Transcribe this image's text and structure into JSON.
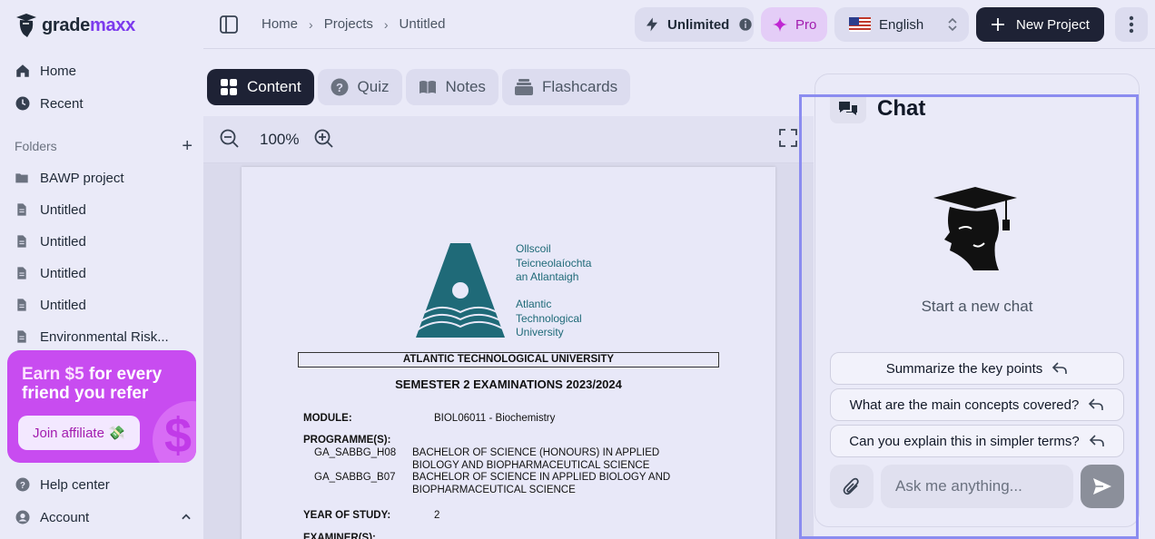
{
  "brand": {
    "part1": "grade",
    "part2": "maxx"
  },
  "sidebar": {
    "nav": [
      {
        "label": "Home"
      },
      {
        "label": "Recent"
      }
    ],
    "folders_label": "Folders",
    "folders_add": "+",
    "items": [
      {
        "label": "BAWP project",
        "type": "folder"
      },
      {
        "label": "Untitled",
        "type": "doc"
      },
      {
        "label": "Untitled",
        "type": "doc"
      },
      {
        "label": "Untitled",
        "type": "doc"
      },
      {
        "label": "Untitled",
        "type": "doc"
      },
      {
        "label": "Environmental Risk...",
        "type": "doc"
      }
    ],
    "promo": {
      "line1_highlight": "Earn $5",
      "line1_rest": " for every",
      "line2": "friend you refer",
      "button": "Join affiliate 💸",
      "badge": "$"
    },
    "help": "Help center",
    "account": "Account"
  },
  "topbar": {
    "breadcrumbs": [
      "Home",
      "Projects",
      "Untitled"
    ],
    "unlimited": "Unlimited",
    "pro": "Pro",
    "language": "English",
    "new_project": "New Project"
  },
  "tabs": [
    {
      "label": "Content",
      "icon": "grid-icon",
      "active": true
    },
    {
      "label": "Quiz",
      "icon": "question-icon",
      "active": false
    },
    {
      "label": "Notes",
      "icon": "book-icon",
      "active": false
    },
    {
      "label": "Flashcards",
      "icon": "cards-icon",
      "active": false
    }
  ],
  "zoom": {
    "value": "100%"
  },
  "document": {
    "irish_name": [
      "Ollscoil",
      "Teicneolaíochta",
      "an Atlantaigh"
    ],
    "english_name": [
      "Atlantic",
      "Technological",
      "University"
    ],
    "title": "ATLANTIC TECHNOLOGICAL UNIVERSITY",
    "semester": "SEMESTER 2 EXAMINATIONS 2023/2024",
    "module_label": "MODULE:",
    "module_value": "BIOL06011 - Biochemistry",
    "programmes_label": "PROGRAMME(S):",
    "programmes": [
      {
        "code": "GA_SABBG_H08",
        "line1": "BACHELOR OF SCIENCE (HONOURS) IN APPLIED",
        "line2": "BIOLOGY AND BIOPHARMACEUTICAL SCIENCE"
      },
      {
        "code": "GA_SABBG_B07",
        "line1": "BACHELOR OF SCIENCE IN APPLIED BIOLOGY AND",
        "line2": "BIOPHARMACEUTICAL SCIENCE"
      }
    ],
    "year_label": "YEAR OF STUDY:",
    "year_value": "2",
    "examiner_label": "EXAMINER(S):"
  },
  "chat": {
    "title": "Chat",
    "start": "Start a new chat",
    "suggestions": [
      "Summarize the key points",
      "What are the main concepts covered?",
      "Can you explain this in simpler terms?"
    ],
    "placeholder": "Ask me anything..."
  },
  "colors": {
    "background": "#eaeaf8",
    "brand_dark": "#1e2235",
    "brand_purple": "#7c3aed",
    "promo": "#c84cf0",
    "atu_teal": "#1f6a78",
    "selection": "#8b8cf0"
  }
}
